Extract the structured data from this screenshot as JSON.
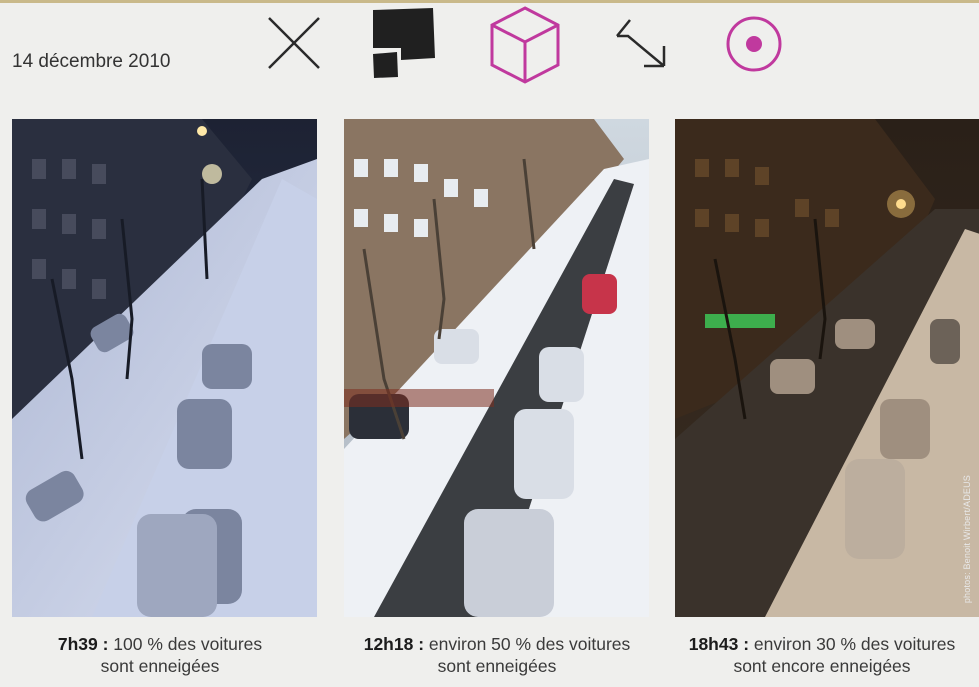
{
  "header": {
    "date": "14 décembre 2010",
    "icons": [
      "close-x-icon",
      "overlapping-squares-icon",
      "cube-icon",
      "diagonal-arrow-icon",
      "target-circle-icon"
    ],
    "accent_color": "#c0399e"
  },
  "photos": [
    {
      "time": "7h39 :",
      "line1": "100 % des voitures",
      "line2": "sont enneigées"
    },
    {
      "time": "12h18 :",
      "line1": "environ 50 % des voitures",
      "line2": "sont enneigées"
    },
    {
      "time": "18h43 :",
      "line1": "environ 30 % des voitures",
      "line2": "sont encore enneigées"
    }
  ],
  "credit": "photos: Benoit Wirbert/ADEUS"
}
